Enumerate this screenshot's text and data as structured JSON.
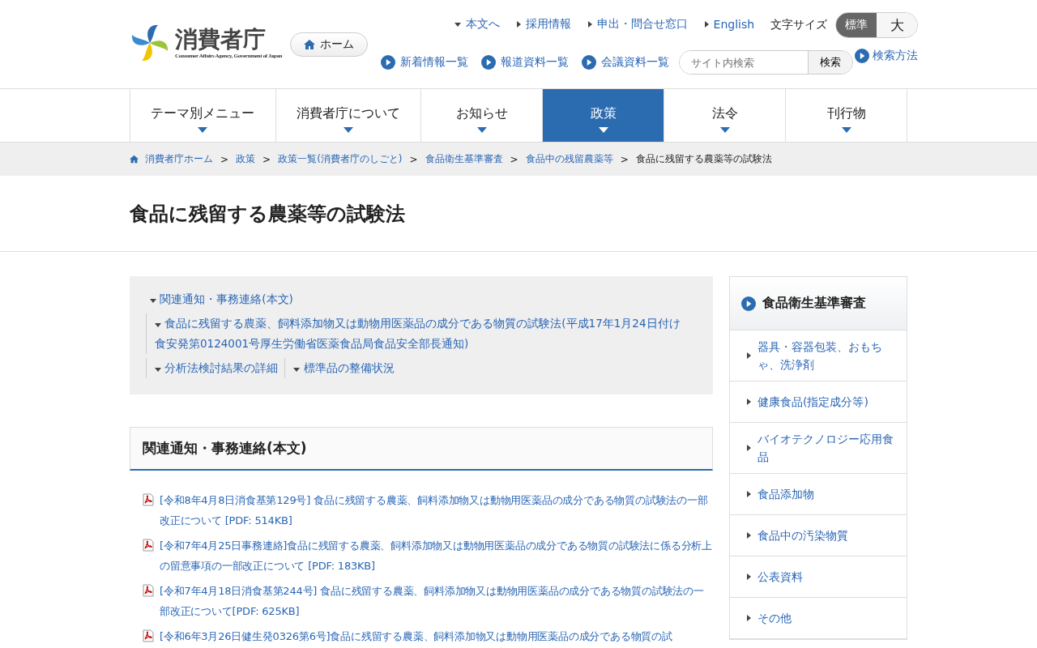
{
  "header": {
    "logo": {
      "name": "消費者庁",
      "subtitle": "Consumer Affairs Agency, Government of Japan"
    },
    "home_button": "ホーム",
    "utility_links": [
      {
        "label": "本文へ",
        "kind": "down"
      },
      {
        "label": "採用情報",
        "kind": "right"
      },
      {
        "label": "申出・問合せ窓口",
        "kind": "right"
      },
      {
        "label": "English",
        "kind": "right"
      }
    ],
    "font_size": {
      "label": "文字サイズ",
      "options": [
        {
          "label": "標準",
          "selected": true
        },
        {
          "label": "大",
          "selected": false
        }
      ]
    },
    "quick_links": [
      "新着情報一覧",
      "報道資料一覧",
      "会議資料一覧"
    ],
    "search": {
      "placeholder": "サイト内検索",
      "button": "検索",
      "help": "検索方法"
    }
  },
  "nav": [
    {
      "label": "テーマ別メニュー",
      "selected": false
    },
    {
      "label": "消費者庁について",
      "selected": false
    },
    {
      "label": "お知らせ",
      "selected": false
    },
    {
      "label": "政策",
      "selected": true
    },
    {
      "label": "法令",
      "selected": false
    },
    {
      "label": "刊行物",
      "selected": false
    }
  ],
  "breadcrumb": {
    "separator": ">",
    "links": [
      "消費者庁ホーム",
      "政策",
      "政策一覧(消費者庁のしごと)",
      "食品衛生基準審査",
      "食品中の残留農薬等"
    ],
    "current": "食品に残留する農薬等の試験法"
  },
  "page_title": "食品に残留する農薬等の試験法",
  "toc": {
    "top": "関連通知・事務連絡(本文)",
    "rows": [
      [
        "食品に残留する農薬、飼料添加物又は動物用医薬品の成分である物質の試験法(平成17年1月24日付け食安発第0124001号厚生労働省医薬食品局食品安全部長通知)"
      ],
      [
        "分析法検討結果の詳細",
        "標準品の整備状況"
      ]
    ]
  },
  "section": {
    "heading": "関連通知・事務連絡(本文)",
    "documents": [
      "[令和8年4月8日消食基第129号] 食品に残留する農薬、飼料添加物又は動物用医薬品の成分である物質の試験法の一部改正について [PDF: 514KB]",
      "[令和7年4月25日事務連絡]食品に残留する農薬、飼料添加物又は動物用医薬品の成分である物質の試験法に係る分析上の留意事項の一部改正について [PDF: 183KB]",
      "[令和7年4月18日消食基第244号] 食品に残留する農薬、飼料添加物又は動物用医薬品の成分である物質の試験法の一部改正について[PDF: 625KB]",
      "[令和6年3月26日健生発0326第6号]食品に残留する農薬、飼料添加物又は動物用医薬品の成分である物質の試"
    ]
  },
  "sidebar": {
    "title": "食品衛生基準審査",
    "items": [
      "器具・容器包装、おもちゃ、洗浄剤",
      "健康食品(指定成分等)",
      "バイオテクノロジー応用食品",
      "食品添加物",
      "食品中の汚染物質",
      "公表資料",
      "その他"
    ]
  }
}
